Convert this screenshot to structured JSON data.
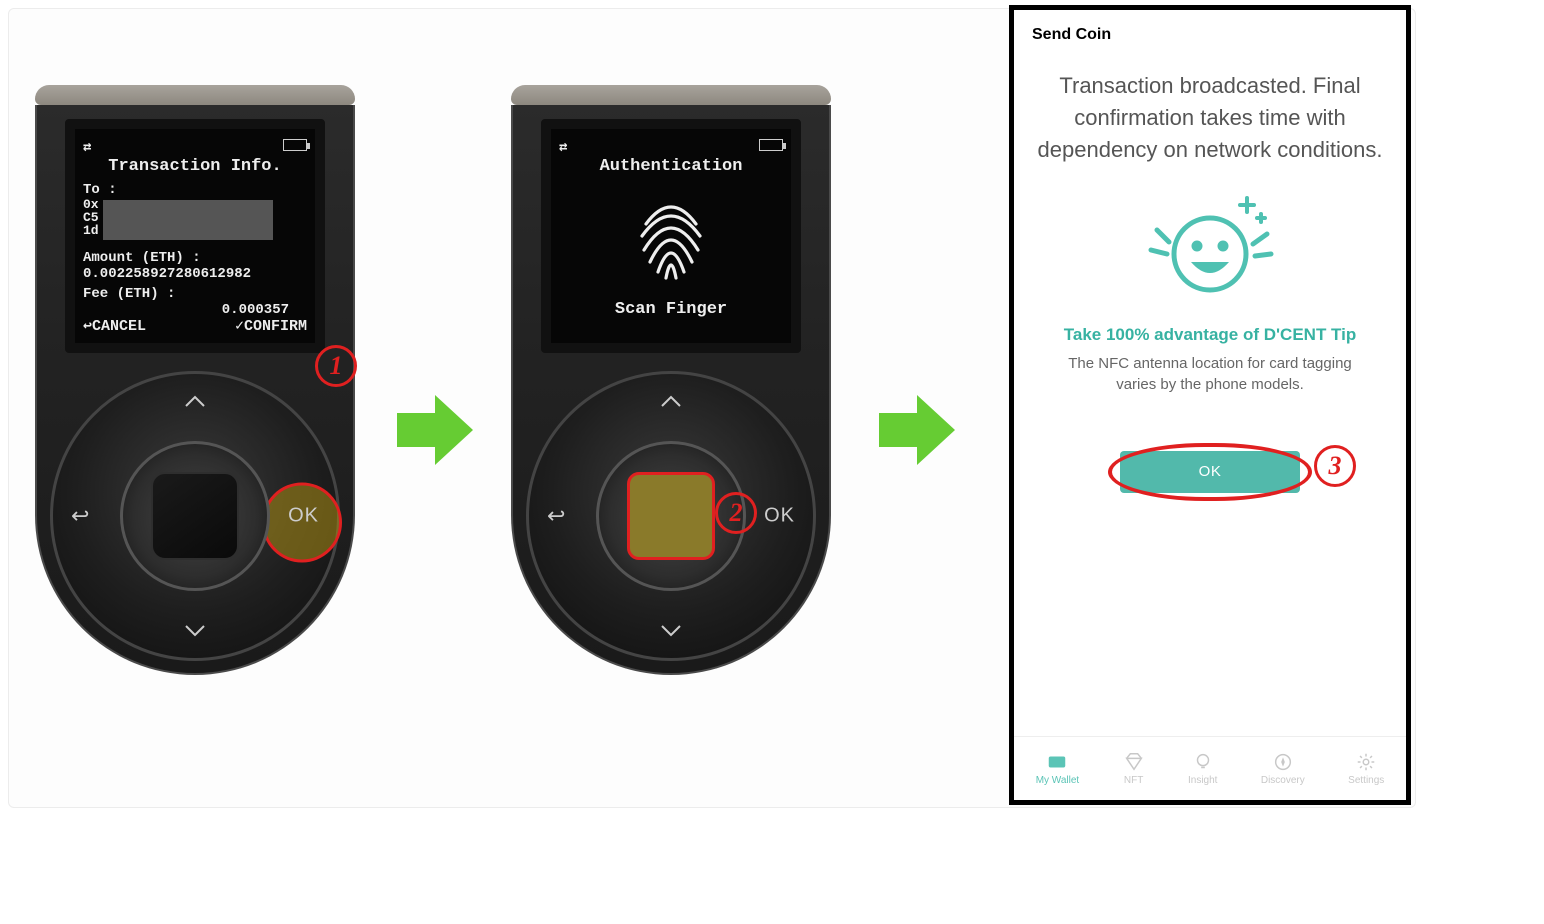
{
  "colors": {
    "accent": "#52b9ab",
    "highlight_red": "#e02020",
    "flow_arrow": "#66cc33"
  },
  "steps": {
    "s1": "1",
    "s2": "2",
    "s3": "3"
  },
  "device1": {
    "screen_title": "Transaction Info.",
    "to_label": "To :",
    "to_addr_prefix1": "0x",
    "to_addr_prefix2": "C5",
    "to_addr_prefix3": "1d",
    "amount_label": "Amount (ETH) :",
    "amount_value": "0.002258927280612982",
    "fee_label": "Fee (ETH) :",
    "fee_value": "0.000357",
    "btn_cancel": "↩CANCEL",
    "btn_confirm": "✓CONFIRM",
    "wheel_ok": "OK"
  },
  "device2": {
    "screen_title": "Authentication",
    "scan_text": "Scan Finger",
    "wheel_ok": "OK"
  },
  "phone": {
    "app_title": "Send Coin",
    "broadcast_msg": "Transaction broadcasted. Final confirmation takes time with dependency on network conditions.",
    "tip_title": "Take 100% advantage of D'CENT Tip",
    "tip_body": "The NFC antenna location for card tagging varies by the phone models.",
    "ok_label": "OK",
    "tabs": [
      {
        "label": "My Wallet",
        "active": true
      },
      {
        "label": "NFT",
        "active": false
      },
      {
        "label": "Insight",
        "active": false
      },
      {
        "label": "Discovery",
        "active": false
      },
      {
        "label": "Settings",
        "active": false
      }
    ]
  }
}
